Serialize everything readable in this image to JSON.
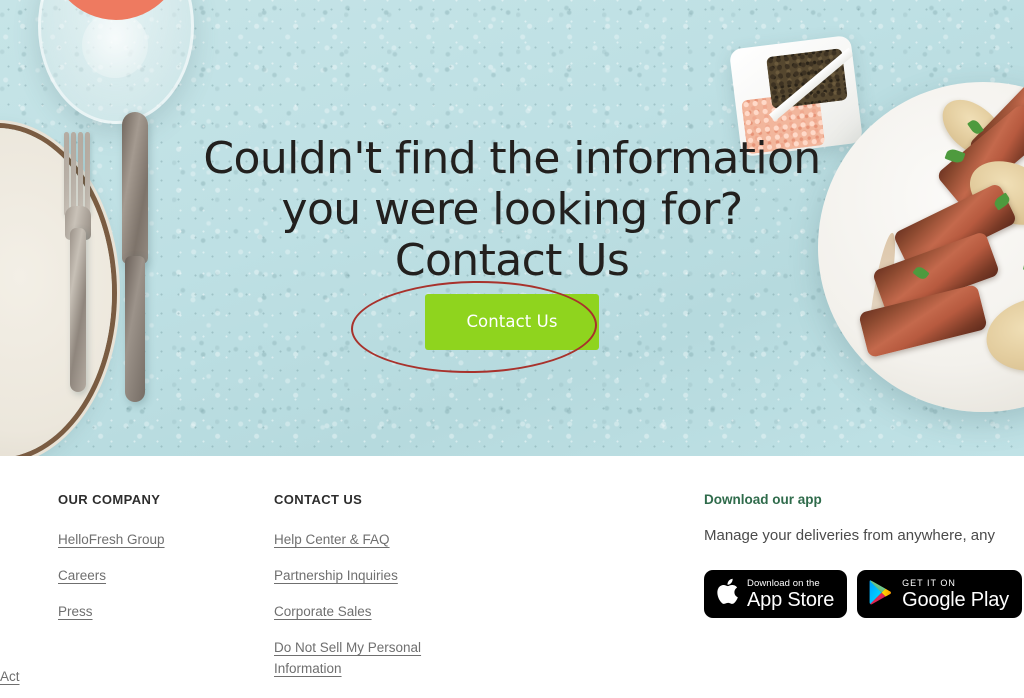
{
  "hero": {
    "headline_lines": [
      "Couldn't find the information",
      "you were looking for?",
      "Contact Us"
    ],
    "cta_label": "Contact Us",
    "cta_color": "#8fd41e",
    "background_color": "#bee0e4",
    "annotation_color": "#a8322c",
    "annotation_shape": "ellipse-highlight-around-contact-us-button",
    "imagery": [
      "rose-wine-glass",
      "white-plate-with-brown-rim",
      "silver-fork",
      "silver-knife",
      "divided-dish-with-peppercorns-and-pink-salt",
      "plate-of-sliced-steak-with-cream-sauce-potatoes-and-herbs"
    ]
  },
  "footer": {
    "company": {
      "heading": "OUR COMPANY",
      "links": [
        "HelloFresh Group",
        "Careers",
        "Press"
      ]
    },
    "contact": {
      "heading": "CONTACT US",
      "links": [
        "Help Center & FAQ",
        "Partnership Inquiries",
        "Corporate Sales",
        "Do Not Sell My Personal Information"
      ]
    },
    "app": {
      "heading": "Download our app",
      "heading_color": "#2f6b4b",
      "tagline": "Manage your deliveries from anywhere, any",
      "badges": [
        {
          "small": "Download on the",
          "big": "App Store",
          "icon": "apple-logo"
        },
        {
          "small": "GET IT ON",
          "big": "Google Play",
          "icon": "google-play-logo"
        }
      ]
    },
    "bottom_partial_link": " Act"
  }
}
